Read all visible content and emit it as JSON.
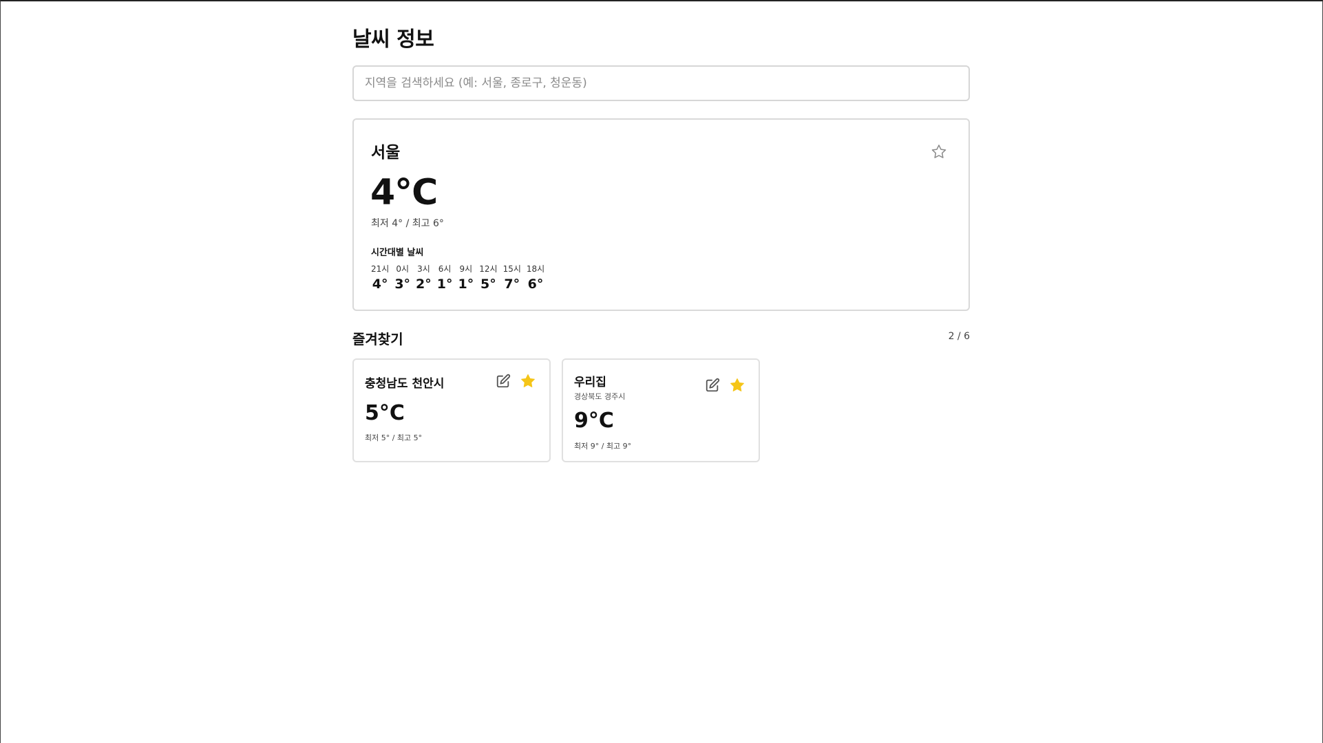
{
  "page": {
    "title": "날씨 정보"
  },
  "search": {
    "placeholder": "지역을 검색하세요 (예: 서울, 종로구, 청운동)",
    "value": ""
  },
  "current": {
    "city": "서울",
    "temp": "4°C",
    "minmax": "최저 4° / 최고 6°",
    "favorite": false,
    "hourly_title": "시간대별 날씨",
    "hourly": [
      {
        "time": "21시",
        "temp": "4°"
      },
      {
        "time": "0시",
        "temp": "3°"
      },
      {
        "time": "3시",
        "temp": "2°"
      },
      {
        "time": "6시",
        "temp": "1°"
      },
      {
        "time": "9시",
        "temp": "1°"
      },
      {
        "time": "12시",
        "temp": "5°"
      },
      {
        "time": "15시",
        "temp": "7°"
      },
      {
        "time": "18시",
        "temp": "6°"
      }
    ]
  },
  "favorites": {
    "title": "즐겨찾기",
    "count": "2 / 6",
    "items": [
      {
        "name": "충청남도 천안시",
        "subtitle": "",
        "temp": "5°C",
        "minmax": "최저 5° / 최고 5°",
        "edit_icon": "edit-icon",
        "star_icon": "star-filled-icon"
      },
      {
        "name": "우리집",
        "subtitle": "경상북도 경주시",
        "temp": "9°C",
        "minmax": "최저 9° / 최고 9°",
        "edit_icon": "edit-icon",
        "star_icon": "star-filled-icon"
      }
    ]
  },
  "colors": {
    "star_active": "#F5C518",
    "star_inactive": "#8a8a8a",
    "icon": "#555555",
    "border": "#d9d9d9"
  }
}
